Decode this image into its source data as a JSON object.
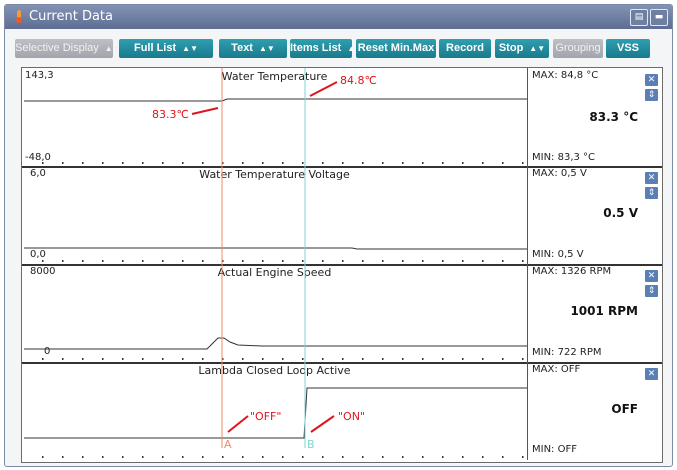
{
  "window": {
    "title": "Current Data"
  },
  "toolbar": {
    "selective_display": "Selective Display",
    "full_list": "Full List",
    "text": "Text",
    "items_list": "Items List",
    "reset": "Reset Min.Max",
    "record": "Record",
    "stop": "Stop",
    "grouping": "Grouping",
    "vss": "VSS"
  },
  "rows": [
    {
      "title": "Water Temperature",
      "ymax": "143,3",
      "ymin": "-48,0",
      "max": "MAX:  84,8 °C",
      "min": "MIN:  83,3 °C",
      "value": "83.3 °C"
    },
    {
      "title": "Water Temperature Voltage",
      "ymax": "6,0",
      "ymin": "0,0",
      "max": "MAX:   0,5 V",
      "min": "MIN:   0,5 V",
      "value": "0.5 V"
    },
    {
      "title": "Actual Engine Speed",
      "ymax": "8000",
      "ymin": "0",
      "max": "MAX:   1326 RPM",
      "min": "MIN:    722 RPM",
      "value": "1001 RPM"
    },
    {
      "title": "Lambda Closed Loop Active",
      "ymax": "",
      "ymin": "",
      "max": "MAX: OFF",
      "min": "MIN: OFF",
      "value": "OFF"
    }
  ],
  "annotations": {
    "temp_a": "83.3℃",
    "temp_b": "84.8℃",
    "off": "\"OFF\"",
    "on": "\"ON\"",
    "marker_a": "A",
    "marker_b": "B"
  },
  "colors": {
    "accent": "#197a8c",
    "annotation": "#e0141e",
    "cursor_a": "#f08a6a",
    "cursor_b": "#7fd4cf"
  }
}
